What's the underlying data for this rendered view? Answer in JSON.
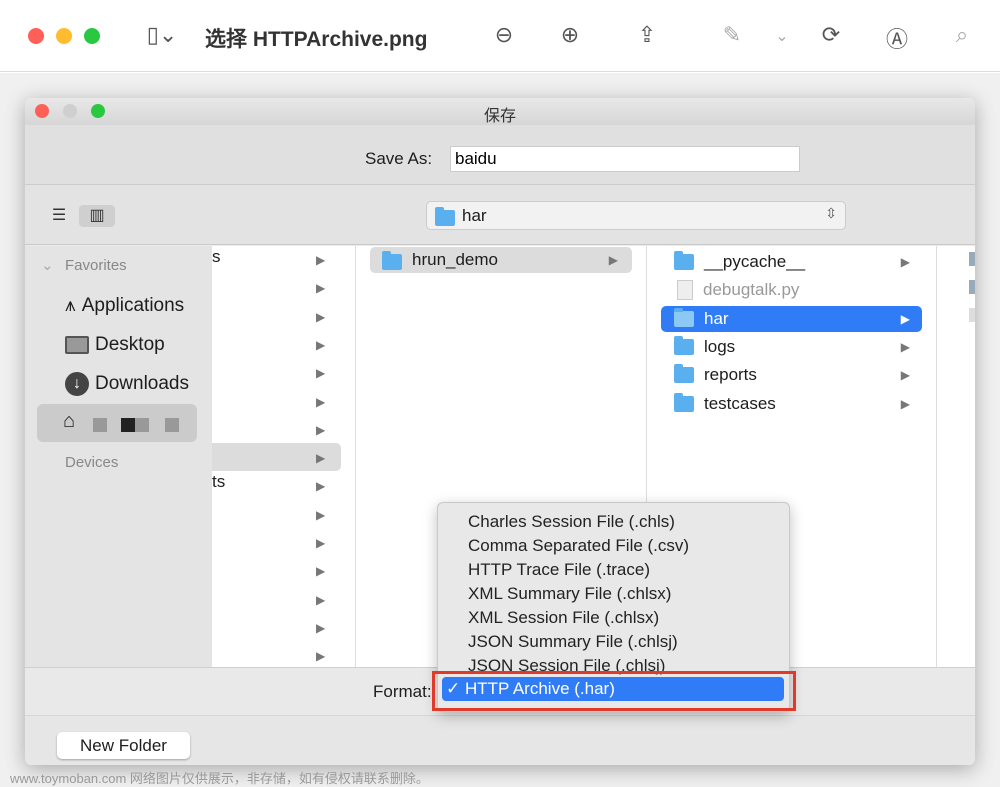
{
  "toolbar": {
    "title": "选择 HTTPArchive.png",
    "icons": [
      "sidebar-icon",
      "zoom-out-icon",
      "zoom-in-icon",
      "share-icon",
      "markup-pen-icon",
      "rotate-icon",
      "annotate-icon",
      "search-icon"
    ]
  },
  "dialog": {
    "title": "保存",
    "save_as_label": "Save As:",
    "save_as_value": "baidu",
    "path": "har"
  },
  "sidebar": {
    "favorites": "Favorites",
    "items": [
      "Applications",
      "Desktop",
      "Downloads"
    ],
    "devices": "Devices"
  },
  "col1": {
    "fragments": [
      "s",
      "ts"
    ]
  },
  "col2": {
    "items": [
      "hrun_demo"
    ]
  },
  "col3": {
    "items": [
      "__pycache__",
      "debugtalk.py",
      "har",
      "logs",
      "reports",
      "testcases"
    ]
  },
  "format": {
    "label": "Format:",
    "options": [
      "Charles Session File (.chls)",
      "Comma Separated File (.csv)",
      "HTTP Trace File (.trace)",
      "XML Summary File (.chlsx)",
      "XML Session File (.chlsx)",
      "JSON Summary File (.chlsj)",
      "JSON Session File (.chlsj)"
    ],
    "selected": "HTTP Archive (.har)",
    "check": "✓"
  },
  "buttons": {
    "new_folder": "New Folder"
  },
  "watermark": "www.toymoban.com 网络图片仅供展示，非存储，如有侵权请联系删除。",
  "colors": {
    "accent": "#2f7cf6",
    "highlight_box": "#e03a2a"
  }
}
